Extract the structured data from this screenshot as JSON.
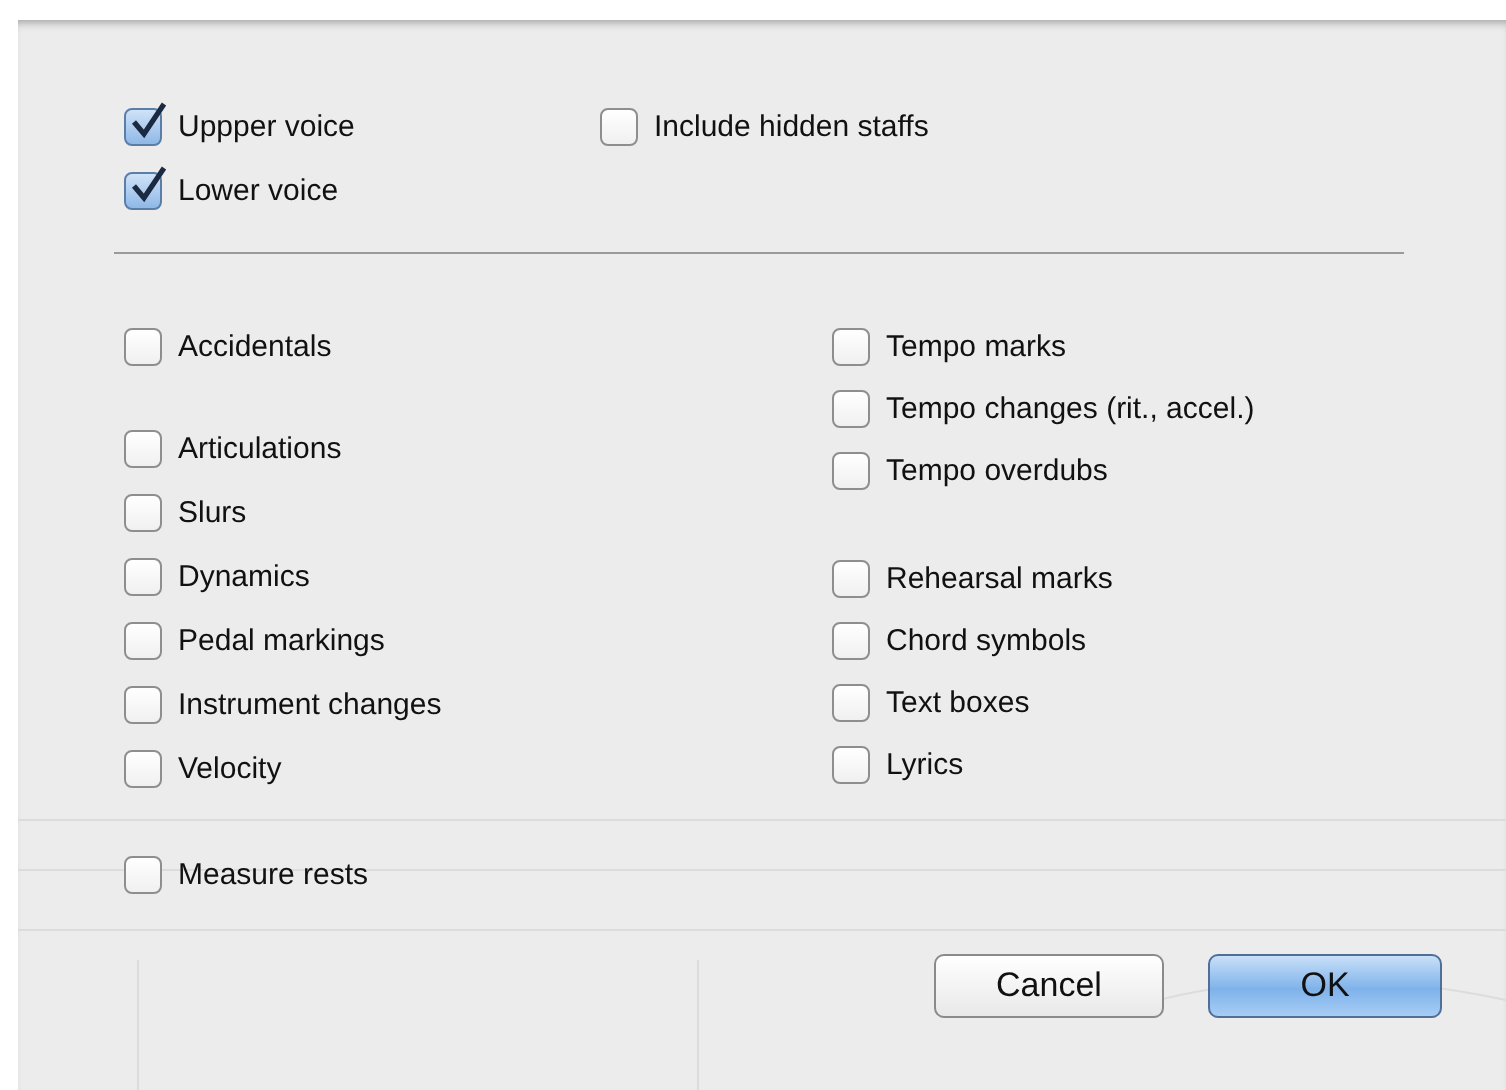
{
  "voices": [
    {
      "label": "Uppper voice",
      "checked": true
    },
    {
      "label": "Lower voice",
      "checked": true
    }
  ],
  "hidden_staffs": {
    "label": "Include hidden staffs",
    "checked": false
  },
  "left_options": [
    {
      "label": "Accidentals",
      "checked": false
    },
    {
      "label": "Articulations",
      "checked": false
    },
    {
      "label": "Slurs",
      "checked": false
    },
    {
      "label": "Dynamics",
      "checked": false
    },
    {
      "label": "Pedal markings",
      "checked": false
    },
    {
      "label": "Instrument changes",
      "checked": false
    },
    {
      "label": "Velocity",
      "checked": false
    }
  ],
  "right_options": [
    {
      "label": "Tempo marks",
      "checked": false
    },
    {
      "label": "Tempo changes (rit., accel.)",
      "checked": false
    },
    {
      "label": "Tempo overdubs",
      "checked": false
    },
    {
      "label": "Rehearsal marks",
      "checked": false
    },
    {
      "label": "Chord symbols",
      "checked": false
    },
    {
      "label": "Text boxes",
      "checked": false
    },
    {
      "label": "Lyrics",
      "checked": false
    }
  ],
  "measure_rests": {
    "label": "Measure rests",
    "checked": false
  },
  "buttons": [
    {
      "label": "Cancel",
      "default": false
    },
    {
      "label": "OK",
      "default": true
    }
  ]
}
